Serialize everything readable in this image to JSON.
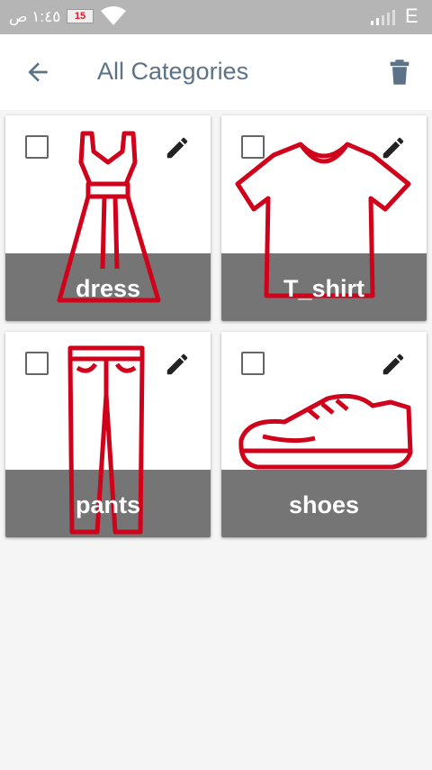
{
  "status_bar": {
    "time": "١:٤٥ ص",
    "battery": "15",
    "network": "E"
  },
  "app_bar": {
    "title": "All Categories",
    "back_icon": "arrow-back-icon",
    "delete_icon": "trash-icon"
  },
  "colors": {
    "accent_red": "#d0021b",
    "title_color": "#5c7387",
    "label_band": "#757575"
  },
  "categories": [
    {
      "name": "dress",
      "icon": "dress-icon"
    },
    {
      "name": "T_shirt",
      "icon": "tshirt-icon"
    },
    {
      "name": "pants",
      "icon": "pants-icon"
    },
    {
      "name": "shoes",
      "icon": "shoe-icon"
    }
  ]
}
